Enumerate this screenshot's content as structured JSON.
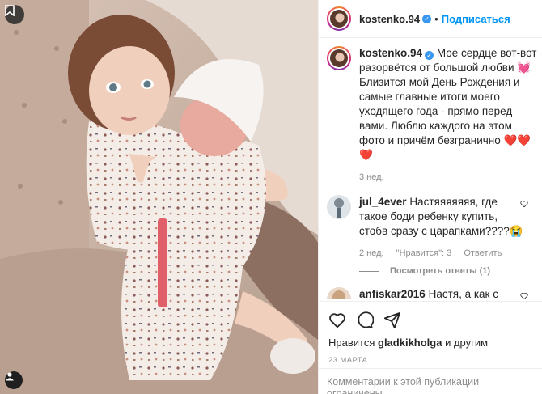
{
  "post": {
    "username": "kostenko.94",
    "separator": "•",
    "follow_label": "Подписаться",
    "caption": "Мое сердце вот-вот разорвётся от большой любви 💓 Близится мой День Рождения и самые главные итоги моего уходящего года - прямо перед вами. Люблю каждого на этом фото и причём безгранично ❤️❤️❤️",
    "caption_age": "3 нед."
  },
  "comments": [
    {
      "username": "jul_4ever",
      "text": "Настяяяяяяя, где такое боди ребенку купить, стобв сразу с царапками????😭",
      "age": "2 нед.",
      "likes_label": "\"Нравится\": 3",
      "reply_label": "Ответить",
      "view_replies": "Посмотреть ответы (1)"
    },
    {
      "username": "anfiskar2016",
      "text": "Настя, а как с коликами поступаете? Моей"
    }
  ],
  "footer": {
    "liked_prefix": "Нравится",
    "liked_user": "gladkikholga",
    "liked_suffix": "и другим",
    "date": "23 МАРТА",
    "comments_closed": "Комментарии к этой публикации ограничены."
  },
  "icons": {
    "like": "heart-icon",
    "comment": "comment-icon",
    "share": "share-icon",
    "verified": "verified-badge-icon",
    "photo_top": "bookmark-icon",
    "photo_bottom": "user-tag-icon"
  },
  "colors": {
    "accent": "#0095f6",
    "verified": "#3897f0",
    "muted": "#8e8e8e",
    "text": "#262626"
  }
}
